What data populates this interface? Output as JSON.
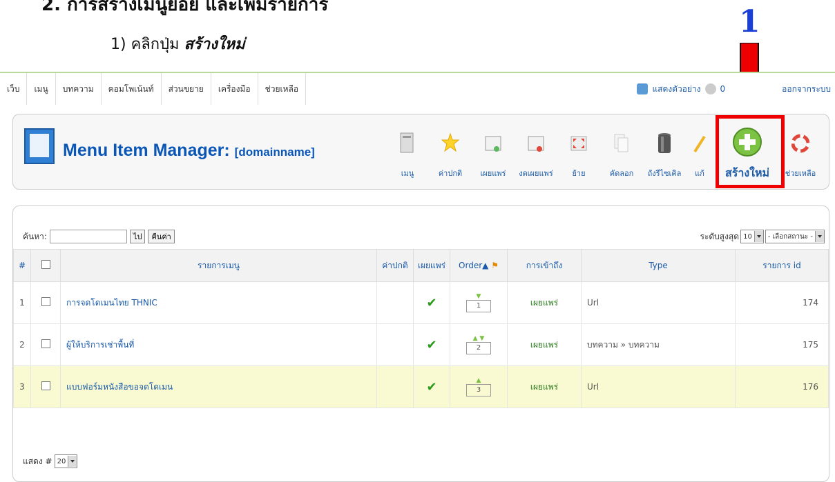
{
  "doc": {
    "heading_fragment": "2. การสร้างเมนูย่อย และเพิ่มรายการ",
    "step_prefix": "1) คลิกปุ่ม",
    "step_action": "สร้างใหม่",
    "marker_number": "1",
    "marker_color": "#1a3fd4",
    "highlight_color": "#e00000"
  },
  "menubar": {
    "items": [
      "เว็บ",
      "เมนู",
      "บทความ",
      "คอมโพเน้นท์",
      "ส่วนขยาย",
      "เครื่องมือ",
      "ช่วยเหลือ"
    ],
    "preview": "แสดงตัวอย่าง",
    "messages_count": "0",
    "logout": "ออกจากระบบ"
  },
  "toolbar": {
    "title": "Menu Item Manager:",
    "subtitle": "[domainname]",
    "buttons": [
      {
        "label": "เมนู",
        "icon": "menu-icon"
      },
      {
        "label": "ค่าปกติ",
        "icon": "star-icon"
      },
      {
        "label": "เผยแพร่",
        "icon": "publish-icon"
      },
      {
        "label": "งดเผยแพร่",
        "icon": "unpublish-icon"
      },
      {
        "label": "ย้าย",
        "icon": "move-icon"
      },
      {
        "label": "คัดลอก",
        "icon": "copy-icon"
      },
      {
        "label": "ถังรีไซเคิล",
        "icon": "trash-icon"
      },
      {
        "label": "แก้",
        "icon": "edit-icon"
      },
      {
        "label": "สร้างใหม่",
        "icon": "new-icon"
      },
      {
        "label": "ช่วยเหลือ",
        "icon": "help-icon"
      }
    ]
  },
  "list": {
    "search_label": "ค้นหา:",
    "search_value": "",
    "go_label": "ไป",
    "reset_label": "คืนค่า",
    "max_level_label": "ระดับสูงสุด",
    "max_level_value": "10",
    "state_filter": "- เลือกสถานะ -",
    "columns": [
      "#",
      "",
      "รายการเมนู",
      "ค่าปกติ",
      "เผยแพร่",
      "Order▲",
      "การเข้าถึง",
      "Type",
      "รายการ id"
    ],
    "rows": [
      {
        "num": "1",
        "title": "การจดโดเมนไทย THNIC",
        "order": "1",
        "access": "เผยแพร่",
        "type": "Url",
        "id": "174"
      },
      {
        "num": "2",
        "title": "ผู้ให้บริการเช่าพื้นที่",
        "order": "2",
        "access": "เผยแพร่",
        "type": "บทความ » บทความ",
        "id": "175"
      },
      {
        "num": "3",
        "title": "แบบฟอร์มหนังสือขอจดโดเมน",
        "order": "3",
        "access": "เผยแพร่",
        "type": "Url",
        "id": "176"
      }
    ],
    "display_label": "แสดง #",
    "display_value": "20"
  }
}
